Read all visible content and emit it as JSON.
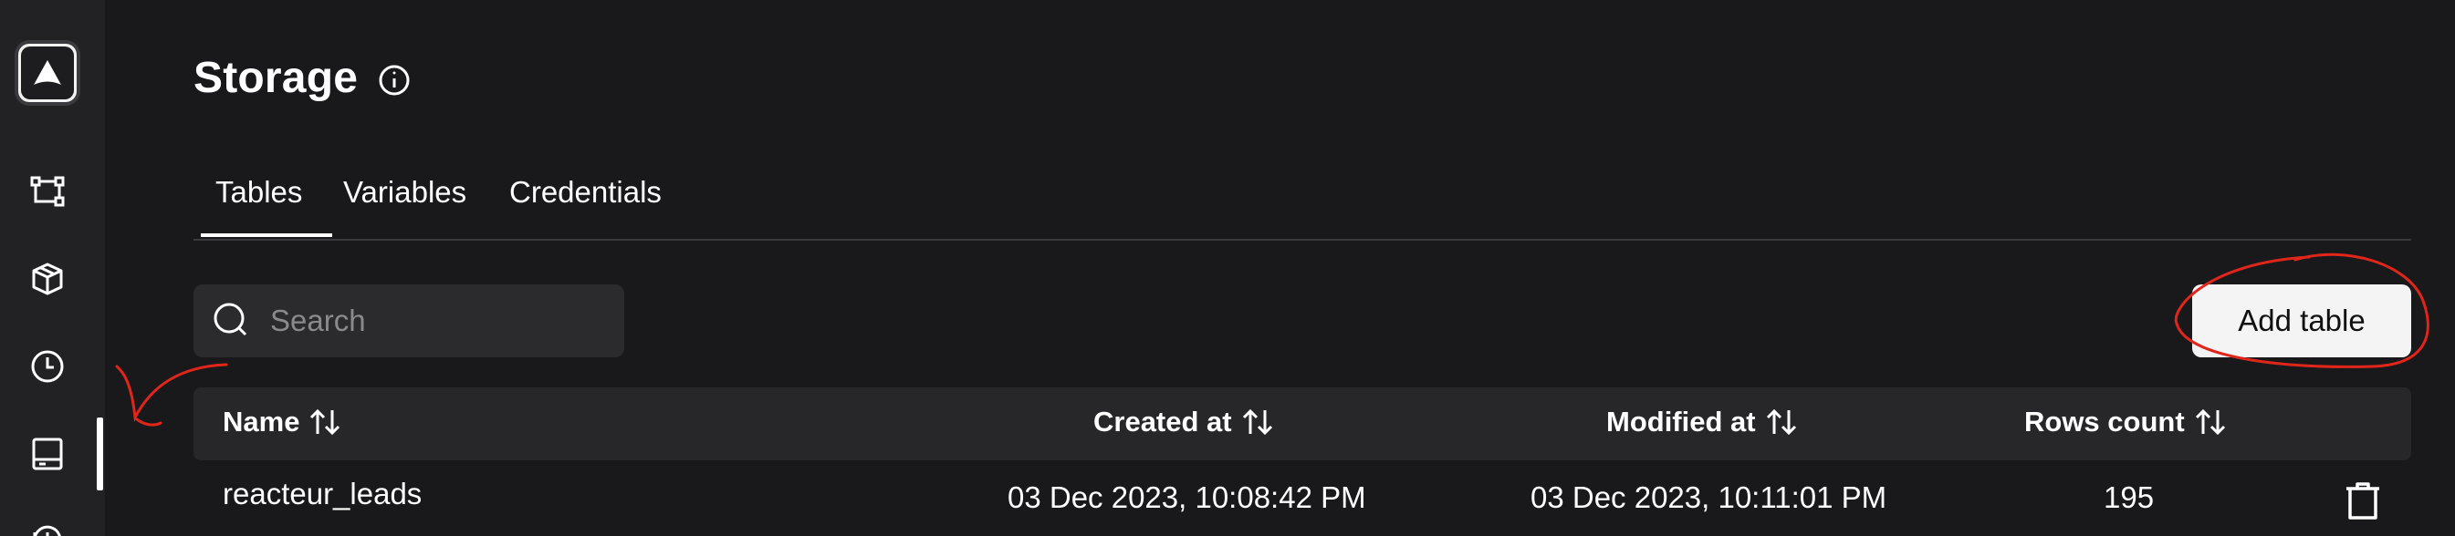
{
  "sidebar": {
    "logo_icon": "app-logo-icon",
    "items": [
      {
        "icon": "workflow-icon"
      },
      {
        "icon": "package-icon"
      },
      {
        "icon": "clock-icon"
      },
      {
        "icon": "storage-icon",
        "active": true
      },
      {
        "icon": "history-icon"
      }
    ]
  },
  "page": {
    "title": "Storage",
    "info_icon": "info-icon"
  },
  "tabs": [
    {
      "label": "Tables",
      "active": true
    },
    {
      "label": "Variables"
    },
    {
      "label": "Credentials"
    }
  ],
  "search": {
    "placeholder": "Search",
    "value": ""
  },
  "toolbar": {
    "add_table_label": "Add table"
  },
  "table": {
    "columns": [
      {
        "label": "Name",
        "sortable": true
      },
      {
        "label": "Created at",
        "sortable": true
      },
      {
        "label": "Modified at",
        "sortable": true
      },
      {
        "label": "Rows count",
        "sortable": true
      }
    ],
    "rows": [
      {
        "name": "reacteur_leads",
        "created_at": "03 Dec 2023, 10:08:42 PM",
        "modified_at": "03 Dec 2023, 10:11:01 PM",
        "rows_count": "195"
      }
    ]
  },
  "colors": {
    "background": "#19191b",
    "sidebar": "#222225",
    "annotation": "#e0261b"
  }
}
